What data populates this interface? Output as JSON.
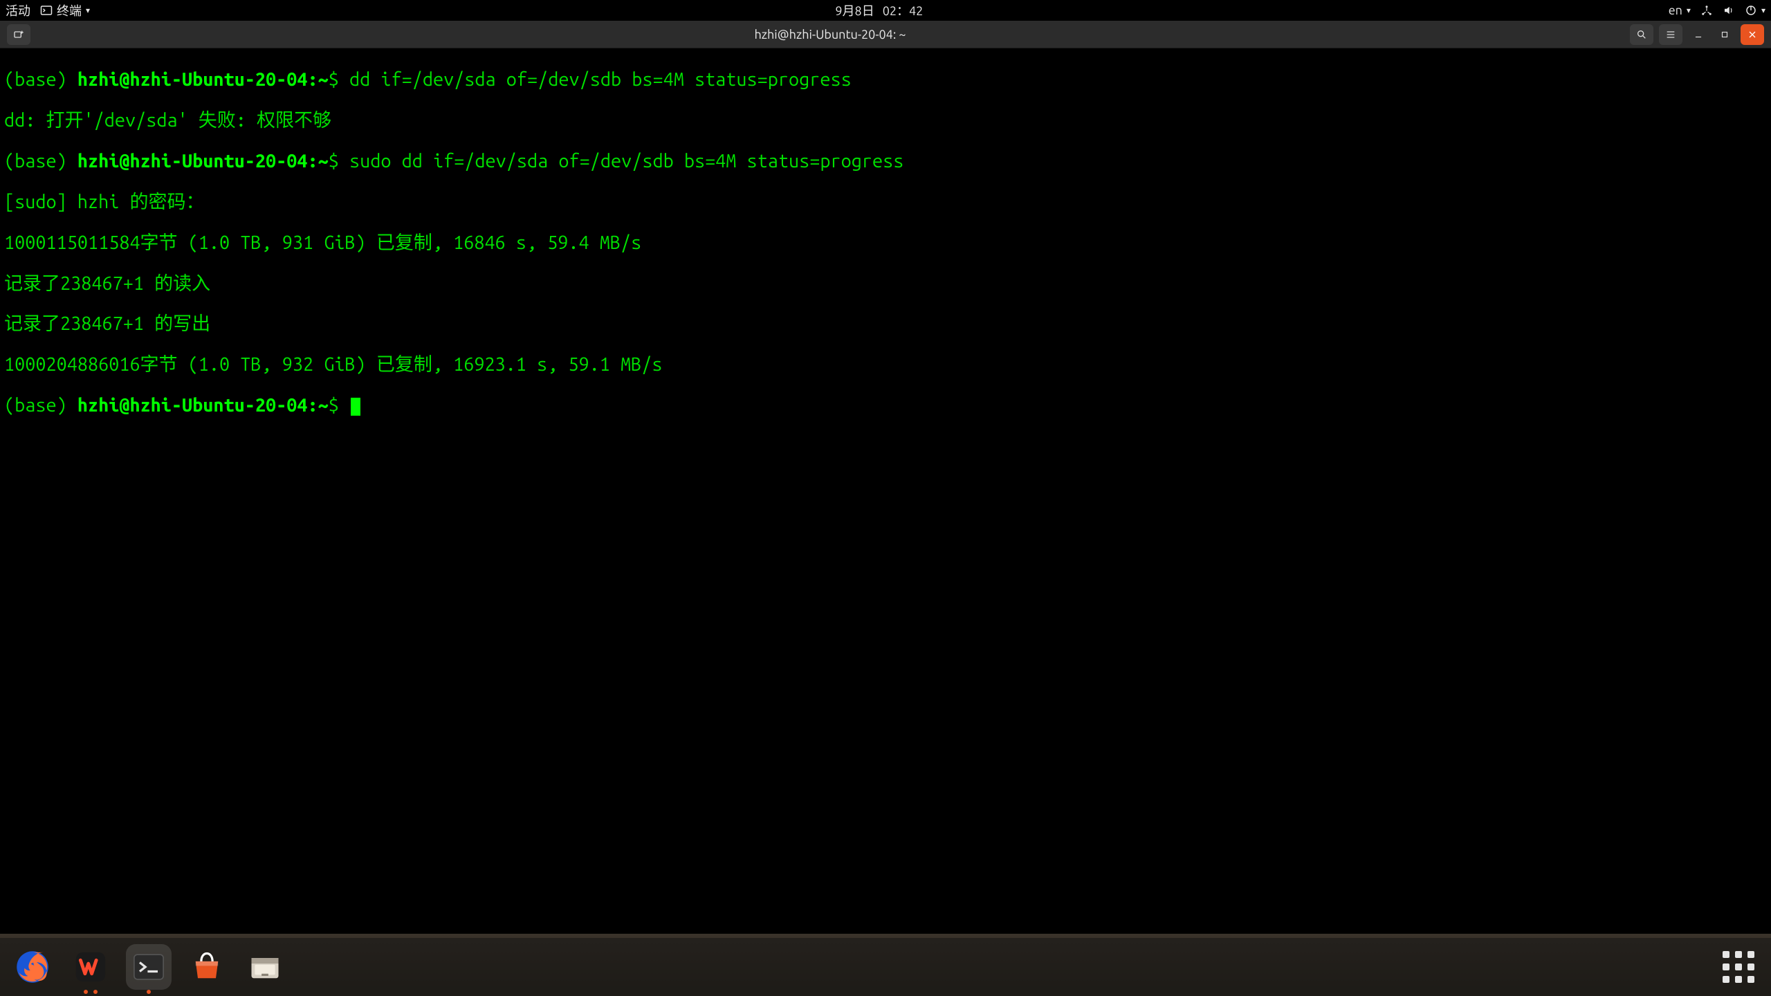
{
  "topbar": {
    "activities": "活动",
    "app_menu": "终端",
    "date": "9月8日",
    "time": "02：42",
    "lang": "en"
  },
  "window": {
    "title": "hzhi@hzhi-Ubuntu-20-04: ~"
  },
  "terminal": {
    "prompt_base": "(base) ",
    "prompt_user": "hzhi@hzhi-Ubuntu-20-04",
    "prompt_path": ":~",
    "prompt_symbol": "$ ",
    "cmd1": "dd if=/dev/sda of=/dev/sdb bs=4M status=progress",
    "out1": "dd: 打开'/dev/sda' 失败: 权限不够",
    "cmd2": "sudo dd if=/dev/sda of=/dev/sdb bs=4M status=progress",
    "out2": "[sudo] hzhi 的密码：",
    "out3": "1000115011584字节 (1.0 TB, 931 GiB) 已复制, 16846 s, 59.4 MB/s",
    "out4": "记录了238467+1 的读入",
    "out5": "记录了238467+1 的写出",
    "out6": "1000204886016字节 (1.0 TB, 932 GiB) 已复制, 16923.1 s, 59.1 MB/s"
  },
  "dock": {
    "firefox": "Firefox",
    "wps": "WPS",
    "terminal": "终端",
    "software": "Ubuntu Software",
    "files": "文件",
    "apps": "显示应用程序"
  }
}
